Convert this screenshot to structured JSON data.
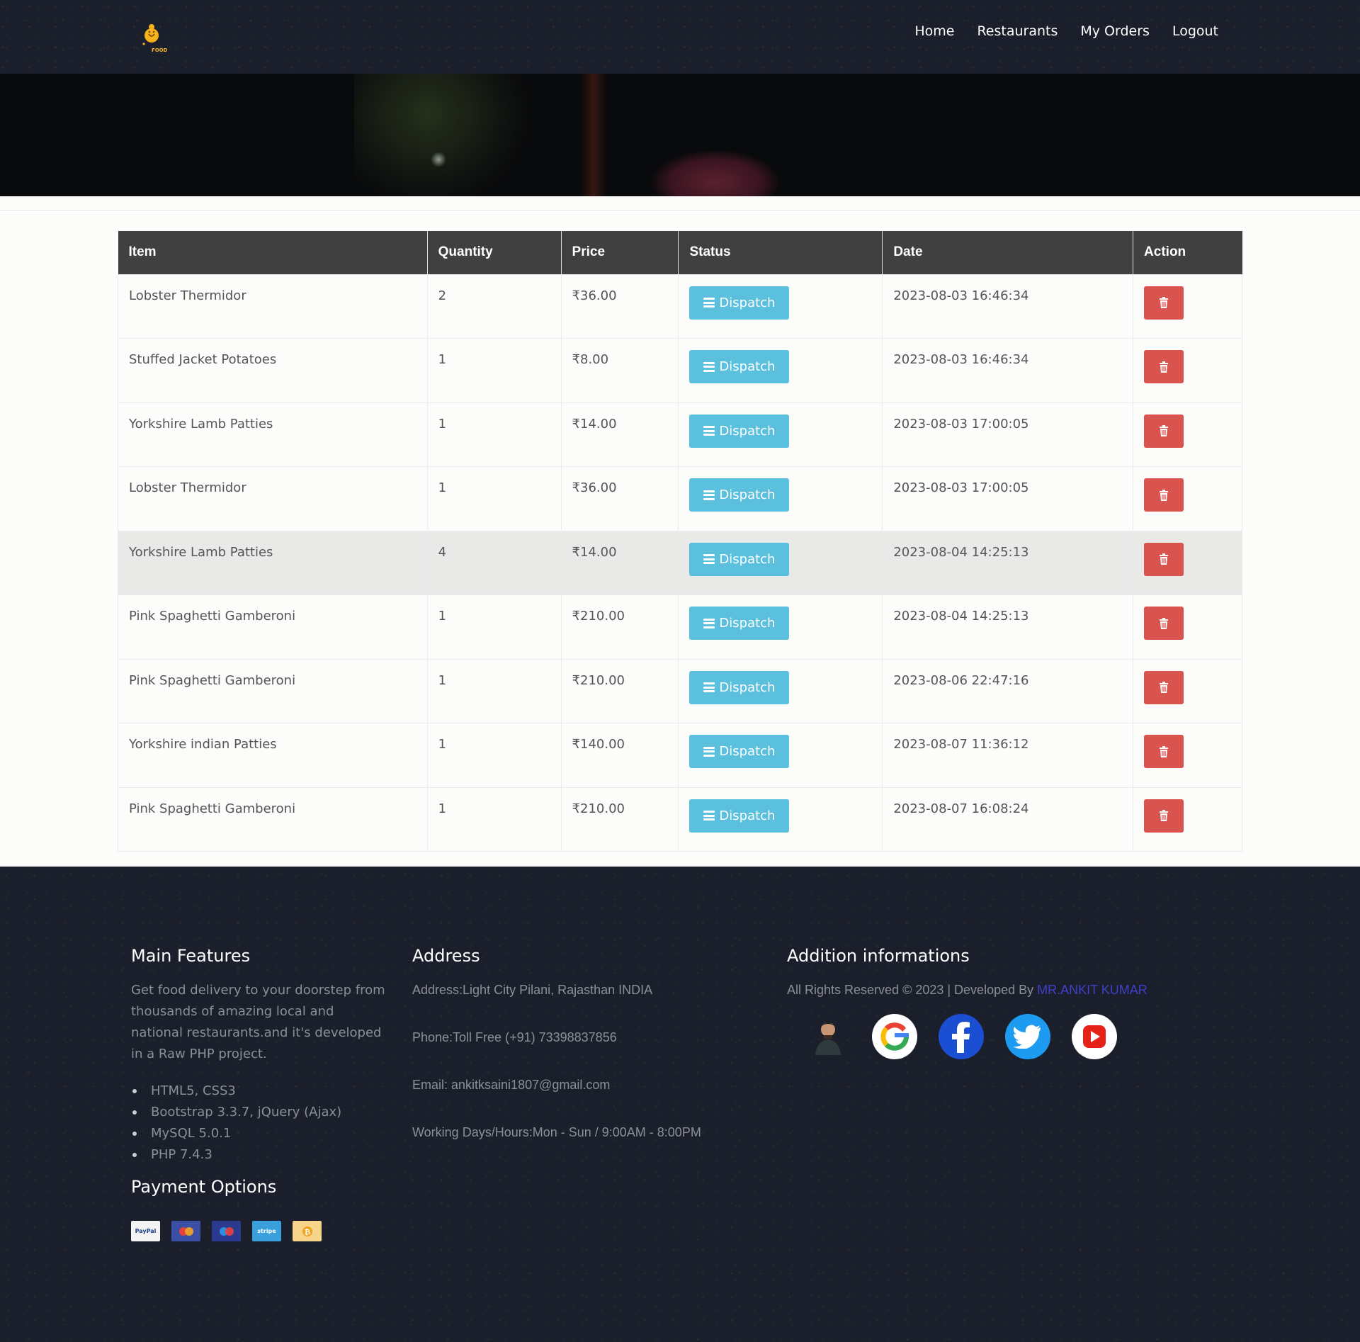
{
  "nav": {
    "home": "Home",
    "restaurants": "Restaurants",
    "my_orders": "My Orders",
    "logout": "Logout"
  },
  "logo": {
    "sub_label": "FOOD"
  },
  "table": {
    "headers": [
      "Item",
      "Quantity",
      "Price",
      "Status",
      "Date",
      "Action"
    ],
    "dispatch_label": "Dispatch",
    "rows": [
      {
        "item": "Lobster Thermidor",
        "quantity": "2",
        "price": "₹36.00",
        "date": "2023-08-03 16:46:34"
      },
      {
        "item": "Stuffed Jacket Potatoes",
        "quantity": "1",
        "price": "₹8.00",
        "date": "2023-08-03 16:46:34"
      },
      {
        "item": "Yorkshire Lamb Patties",
        "quantity": "1",
        "price": "₹14.00",
        "date": "2023-08-03 17:00:05"
      },
      {
        "item": "Lobster Thermidor",
        "quantity": "1",
        "price": "₹36.00",
        "date": "2023-08-03 17:00:05"
      },
      {
        "item": "Yorkshire Lamb Patties",
        "quantity": "4",
        "price": "₹14.00",
        "date": "2023-08-04 14:25:13"
      },
      {
        "item": "Pink Spaghetti Gamberoni",
        "quantity": "1",
        "price": "₹210.00",
        "date": "2023-08-04 14:25:13"
      },
      {
        "item": "Pink Spaghetti Gamberoni",
        "quantity": "1",
        "price": "₹210.00",
        "date": "2023-08-06 22:47:16"
      },
      {
        "item": "Yorkshire indian Patties",
        "quantity": "1",
        "price": "₹140.00",
        "date": "2023-08-07 11:36:12"
      },
      {
        "item": "Pink Spaghetti Gamberoni",
        "quantity": "1",
        "price": "₹210.00",
        "date": "2023-08-07 16:08:24"
      }
    ]
  },
  "footer": {
    "features": {
      "title": "Main Features",
      "text": "Get food delivery to your doorstep from thousands of amazing local and national restaurants.and it's developed in a Raw PHP project.",
      "list": [
        "HTML5, CSS3",
        "Bootstrap 3.3.7, jQuery (Ajax)",
        "MySQL 5.0.1",
        "PHP 7.4.3"
      ]
    },
    "payment": {
      "title": "Payment Options",
      "paypal": "PayPal",
      "stripe": "stripe"
    },
    "address": {
      "title": "Address",
      "address": "Address:Light City Pilani, Rajasthan INDIA",
      "phone": "Phone:Toll Free (+91) 73398837856",
      "email": "Email: ankitksaini1807@gmail.com",
      "hours": "Working Days/Hours:Mon - Sun / 9:00AM - 8:00PM"
    },
    "info": {
      "title": "Addition informations",
      "rights": "All Rights Reserved © 2023 | Developed By ",
      "developer": "MR.ANKIT KUMAR"
    }
  },
  "colors": {
    "header_bg": "#1b1f2b",
    "table_header": "#404040",
    "dispatch": "#5bc0de",
    "delete": "#d9534f",
    "link": "#3f3fc8"
  }
}
